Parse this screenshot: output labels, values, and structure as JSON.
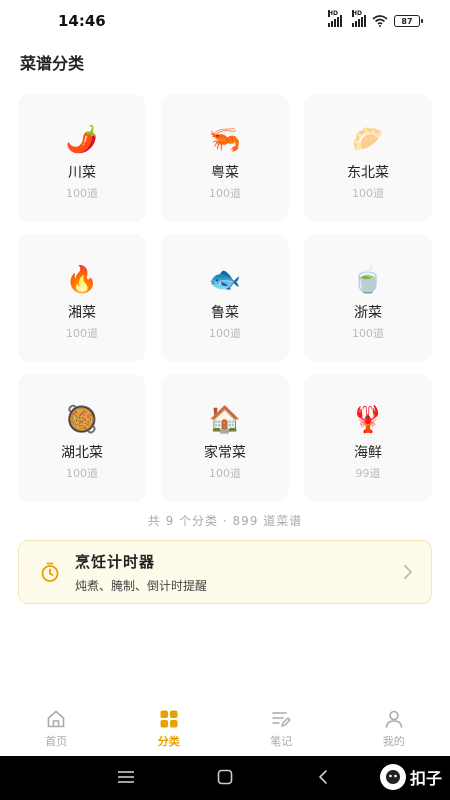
{
  "status": {
    "time": "14:46",
    "battery": "87"
  },
  "header": {
    "title": "菜谱分类"
  },
  "categories": [
    {
      "icon": "🌶️",
      "icon_name": "chili-pepper-icon",
      "name": "川菜",
      "count": "100道"
    },
    {
      "icon": "🦐",
      "icon_name": "shrimp-icon",
      "name": "粤菜",
      "count": "100道"
    },
    {
      "icon": "🥟",
      "icon_name": "dumpling-icon",
      "name": "东北菜",
      "count": "100道"
    },
    {
      "icon": "🔥",
      "icon_name": "fire-icon",
      "name": "湘菜",
      "count": "100道"
    },
    {
      "icon": "🐟",
      "icon_name": "fish-icon",
      "name": "鲁菜",
      "count": "100道"
    },
    {
      "icon": "🍵",
      "icon_name": "tea-icon",
      "name": "浙菜",
      "count": "100道"
    },
    {
      "icon": "🥘",
      "icon_name": "stew-pot-icon",
      "name": "湖北菜",
      "count": "100道"
    },
    {
      "icon": "🏠",
      "icon_name": "house-icon",
      "name": "家常菜",
      "count": "100道"
    },
    {
      "icon": "🦞",
      "icon_name": "lobster-icon",
      "name": "海鲜",
      "count": "99道"
    }
  ],
  "summary": "共 9 个分类 · 899 道菜谱",
  "timer": {
    "title": "烹饪计时器",
    "subtitle": "炖煮、腌制、倒计时提醒"
  },
  "tabs": [
    {
      "label": "首页",
      "icon_name": "home-icon",
      "active": false
    },
    {
      "label": "分类",
      "icon_name": "grid-icon",
      "active": true
    },
    {
      "label": "笔记",
      "icon_name": "notes-icon",
      "active": false
    },
    {
      "label": "我的",
      "icon_name": "profile-icon",
      "active": false
    }
  ],
  "watermark": {
    "text": "扣子"
  },
  "colors": {
    "accent": "#e8a200",
    "timer_bg": "#fffbea",
    "card_bg": "#f9f9f9"
  }
}
